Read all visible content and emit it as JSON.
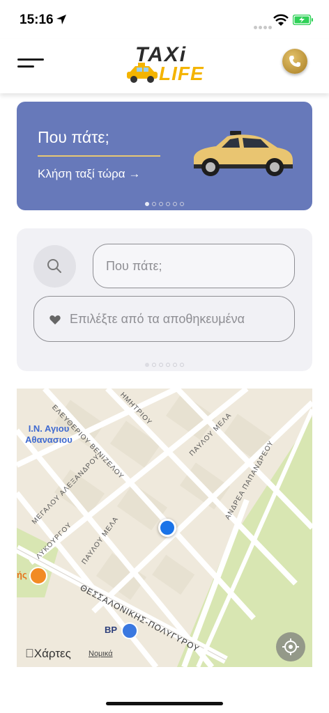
{
  "status": {
    "time": "15:16"
  },
  "header": {
    "logo_top": "TAXi",
    "logo_bottom": "LIFE"
  },
  "banner": {
    "title": "Που πάτε;",
    "cta": "Κλήση ταξί τώρα →",
    "page_count": 6,
    "active_page": 0,
    "background": "#6779ba"
  },
  "search": {
    "destination_placeholder": "Που πάτε;",
    "saved_label": "Επιλέξτε από τα αποθηκευμένα",
    "page_count": 6,
    "active_page": 0
  },
  "map": {
    "poi_church": "Ι.Ν. Αγιου\nΑθανασιου",
    "streets": {
      "eleftheriou": "ΕΛΕΥΘΕΡΙΟΥ ΒΕΝΙΖΕΛΟΥ",
      "dimitriou": "ΗΜΗΤΡΙΟΥ",
      "pavlou_mela_top": "ΠΑΥΛΟΥ ΜΕΛΑ",
      "andrea": "ΑΝΔΡΕΑ ΠΑΠΑΝΔΡΕΟΥ",
      "megalou": "ΜΕΓΑΛΟΥ ΑΛΕΞΑΝΔΡΟΥ",
      "lykourgou": "ΛΥΚΟΥΡΓΟΥ",
      "pavlou_mela_bottom": "ΠΑΥΛΟΥ ΜΕΛΑ",
      "thessalonikis": "ΘΕΣΣΑΛΟΝΙΚΗΣ-ΠΟΛΥΓΥΡΟΥ"
    },
    "fuel_label": "BP",
    "food_label": "ής",
    "brand": "Χάρτες",
    "legal": "Νομικά"
  }
}
